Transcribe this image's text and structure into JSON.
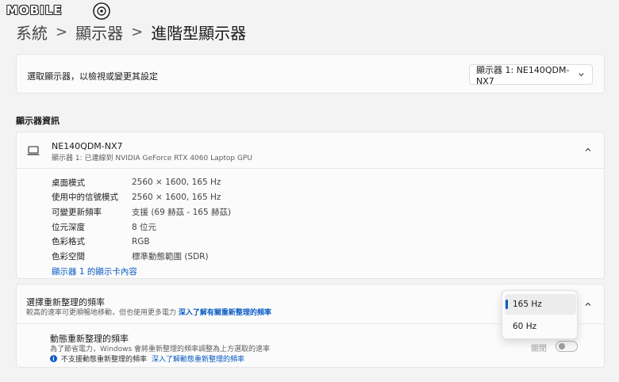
{
  "watermark": {
    "logo_text": "MOBILE"
  },
  "breadcrumb": {
    "items": [
      "系統",
      "顯示器",
      "進階型顯示器"
    ],
    "separator": ">"
  },
  "display_select": {
    "label": "選取顯示器，以檢視或變更其設定",
    "value": "顯示器 1: NE140QDM-NX7"
  },
  "display_info": {
    "section_title": "顯示器資訊",
    "name": "NE140QDM-NX7",
    "subtitle": "顯示器 1: 已連線到 NVIDIA GeForce RTX 4060 Laptop GPU",
    "rows": [
      {
        "key": "桌面模式",
        "value": "2560 × 1600, 165 Hz"
      },
      {
        "key": "使用中的信號模式",
        "value": "2560 × 1600, 165 Hz"
      },
      {
        "key": "可變更新頻率",
        "value": "支援 (69 赫茲 - 165 赫茲)"
      },
      {
        "key": "位元深度",
        "value": "8 位元"
      },
      {
        "key": "色彩格式",
        "value": "RGB"
      },
      {
        "key": "色彩空間",
        "value": "標準動態範圍 (SDR)"
      }
    ],
    "adapter_link": "顯示器 1 的顯示卡內容"
  },
  "refresh_rate": {
    "title": "選擇重新整理的頻率",
    "subtitle": "較高的速率可更順暢地移動，但也使用更多電力",
    "learn_link": "深入了解有關重新整理的頻率",
    "options": [
      "165 Hz",
      "60 Hz"
    ],
    "selected": "165 Hz"
  },
  "dynamic_refresh": {
    "title": "動態重新整理的頻率",
    "subtitle": "為了節省電力，Windows 會將重新整理的頻率調整為上方選取的速率",
    "note": "不支援動態重新整理的頻率",
    "note_link": "深入了解動態重新整理的頻率",
    "toggle_label": "關閉",
    "toggle_on": false
  },
  "colors": {
    "accent": "#0a5bc4",
    "background": "#f3f3f3",
    "card": "#fbfbfb"
  }
}
